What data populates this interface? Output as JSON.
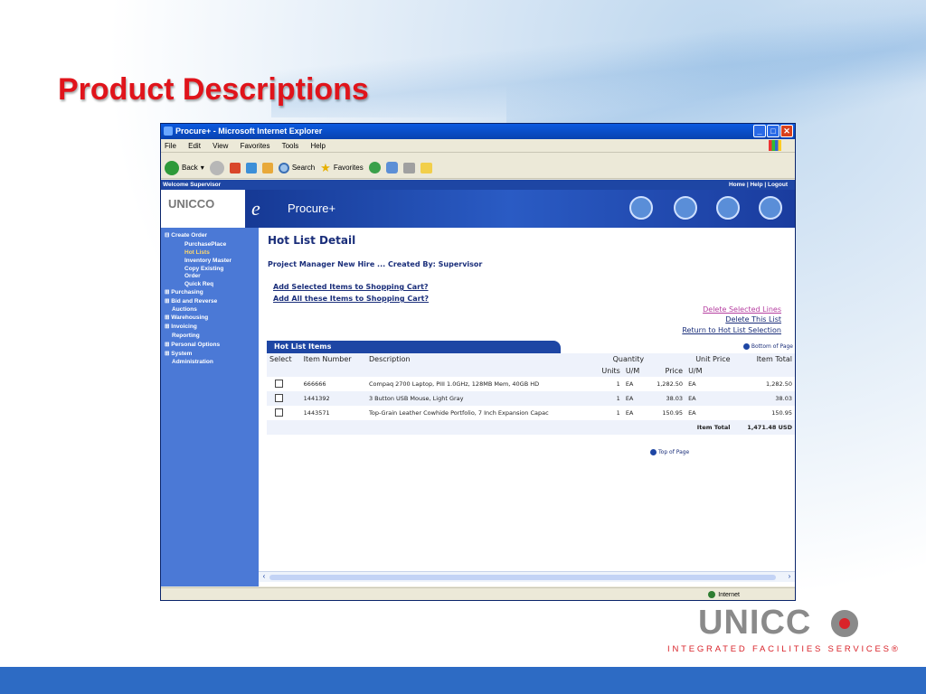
{
  "slide": {
    "title": "Product Descriptions",
    "logo_word": "UNICC",
    "logo_subtitle": "INTEGRATED FACILITIES SERVICES®",
    "colors": {
      "title": "#e0141b",
      "bottom_bar": "#2d6bc4",
      "logo_red": "#d9232a",
      "logo_gray": "#8a8a8a"
    }
  },
  "browser": {
    "window_title": "Procure+ - Microsoft Internet Explorer",
    "menu": [
      "File",
      "Edit",
      "View",
      "Favorites",
      "Tools",
      "Help"
    ],
    "toolbar": {
      "back": "Back",
      "search": "Search",
      "favorites": "Favorites"
    },
    "status_zone": "Internet"
  },
  "app": {
    "welcome": "Welcome Supervisor",
    "top_links": "Home  |  Help  |  Logout",
    "logo_word": "UNICCO",
    "brand_e": "e",
    "brand_name": "Procure+",
    "sidebar": [
      {
        "label": "Create Order",
        "type": "section"
      },
      {
        "label": "PurchasePlace",
        "type": "sub"
      },
      {
        "label": "Hot Lists",
        "type": "sub-active"
      },
      {
        "label": "Inventory Master",
        "type": "sub"
      },
      {
        "label": "Copy Existing",
        "type": "sub"
      },
      {
        "label": "Order",
        "type": "sub2"
      },
      {
        "label": "Quick Req",
        "type": "sub"
      },
      {
        "label": "Purchasing",
        "type": "section"
      },
      {
        "label": "Bid and Reverse",
        "type": "section"
      },
      {
        "label": "Auctions",
        "type": "sub2"
      },
      {
        "label": "Warehousing",
        "type": "section"
      },
      {
        "label": "Invoicing",
        "type": "section"
      },
      {
        "label": "Reporting",
        "type": "sub-plain"
      },
      {
        "label": "Personal Options",
        "type": "section"
      },
      {
        "label": "System",
        "type": "section"
      },
      {
        "label": "Administration",
        "type": "sub2"
      }
    ],
    "detail": {
      "heading": "Hot List Detail",
      "project_line": "Project Manager New Hire ... Created By: Supervisor",
      "add_selected": "Add Selected Items to Shopping Cart?",
      "add_all": "Add All these Items to Shopping Cart?",
      "delete_selected": "Delete Selected Lines",
      "delete_list": "Delete This List",
      "return_link": "Return to Hot List Selection",
      "table_title": "Hot List Items",
      "bottom_of_page": "Bottom of Page",
      "top_of_page": "Top of Page",
      "columns": {
        "select": "Select",
        "item_number": "Item Number",
        "description": "Description",
        "quantity": "Quantity",
        "units": "Units",
        "um1": "U/M",
        "unit_price": "Unit Price",
        "price": "Price",
        "um2": "U/M",
        "item_total": "Item Total"
      },
      "rows": [
        {
          "item": "666666",
          "desc": "Compaq 2700 Laptop, PIII 1.0GHz, 128MB Mem, 40GB HD",
          "qty": "1",
          "um": "EA",
          "price": "1,282.50",
          "um2": "EA",
          "total": "1,282.50"
        },
        {
          "item": "1441392",
          "desc": "3 Button USB Mouse, Light Gray",
          "qty": "1",
          "um": "EA",
          "price": "38.03",
          "um2": "EA",
          "total": "38.03"
        },
        {
          "item": "1443571",
          "desc": "Top-Grain Leather Cowhide Portfolio, 7 Inch Expansion Capac",
          "qty": "1",
          "um": "EA",
          "price": "150.95",
          "um2": "EA",
          "total": "150.95"
        }
      ],
      "total_label": "Item Total",
      "total_value": "1,471.48",
      "currency": "USD"
    }
  }
}
